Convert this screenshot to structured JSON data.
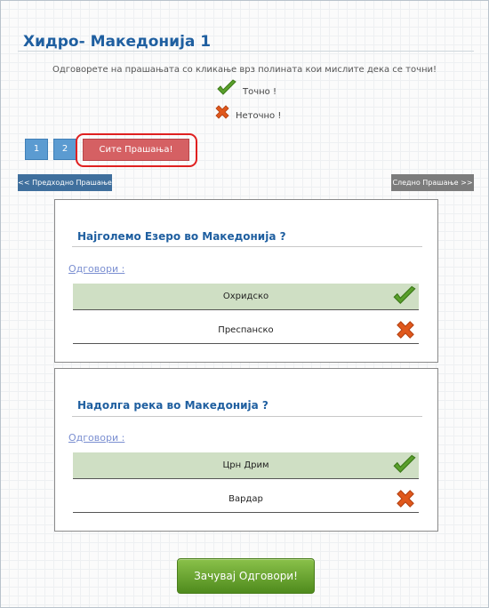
{
  "page": {
    "title": "Хидро- Македонија 1",
    "instructions": "Одговорете на прашањата со кликање врз полината кои мислите дека се точни!"
  },
  "legend": {
    "correct_label": "Точно !",
    "wrong_label": "Неточно !"
  },
  "pagination": {
    "pages": [
      "1",
      "2"
    ],
    "all_questions_label": "Сите Прашања!"
  },
  "nav": {
    "prev_label": "<< Предходно Прашање",
    "next_label": "Следно Прашање >>"
  },
  "questions": [
    {
      "title": "Најголемо Езеро во Македонија ?",
      "answers_label": "Одговори :",
      "answers": [
        {
          "text": "Охридско",
          "status": "correct"
        },
        {
          "text": "Преспанско",
          "status": "wrong"
        }
      ]
    },
    {
      "title": "Надолга река во Македонија ?",
      "answers_label": "Одговори :",
      "answers": [
        {
          "text": "Црн Дрим",
          "status": "correct"
        },
        {
          "text": "Вардар",
          "status": "wrong"
        }
      ]
    }
  ],
  "submit": {
    "label": "Зачувај Одговори!"
  },
  "colors": {
    "title_blue": "#1f5fa0",
    "correct_row_bg": "#cfdfc4",
    "all_questions_red": "#d56063",
    "submit_green": "#6aa432"
  },
  "icons": {
    "correct": "checkmark-icon",
    "wrong": "cross-icon"
  }
}
